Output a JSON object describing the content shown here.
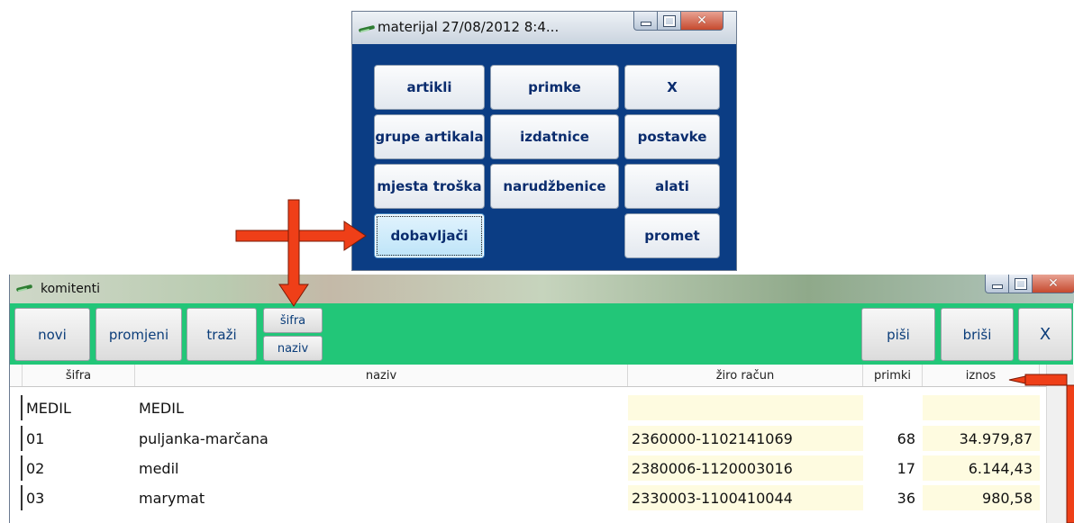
{
  "materijal_window": {
    "title": "materijal 27/08/2012  8:4...",
    "buttons": [
      "artikli",
      "primke",
      "X",
      "grupe artikala",
      "izdatnice",
      "postavke",
      "mjesta troška",
      "narudžbenice",
      "alati",
      "dobavljači",
      "promet"
    ],
    "active_button": "dobavljači"
  },
  "komitenti_window": {
    "title": "komitenti",
    "toolbar": {
      "novi": "novi",
      "promjeni": "promjeni",
      "trazi": "traži",
      "sifra": "šifra",
      "naziv": "naziv",
      "pisi": "piši",
      "brisi": "briši",
      "close": "X"
    },
    "columns": [
      "šifra",
      "naziv",
      "žiro račun",
      "primki",
      "iznos"
    ],
    "rows": [
      {
        "sifra": "MEDIL",
        "naziv": "MEDIL",
        "ziro": "",
        "primki": "",
        "iznos": ""
      },
      {
        "sifra": "01",
        "naziv": "puljanka-marčana",
        "ziro": "2360000-1102141069",
        "primki": "68",
        "iznos": "34.979,87"
      },
      {
        "sifra": "02",
        "naziv": "medil",
        "ziro": "2380006-1120003016",
        "primki": "17",
        "iznos": "6.144,43"
      },
      {
        "sifra": "03",
        "naziv": "marymat",
        "ziro": "2330003-1100410044",
        "primki": "36",
        "iznos": "980,58"
      }
    ]
  },
  "colors": {
    "menu_background": "#0b3d84",
    "toolbar_green": "#22c678",
    "annotation_arrow": "#ef3f18",
    "cell_cream": "#fefbe0"
  }
}
